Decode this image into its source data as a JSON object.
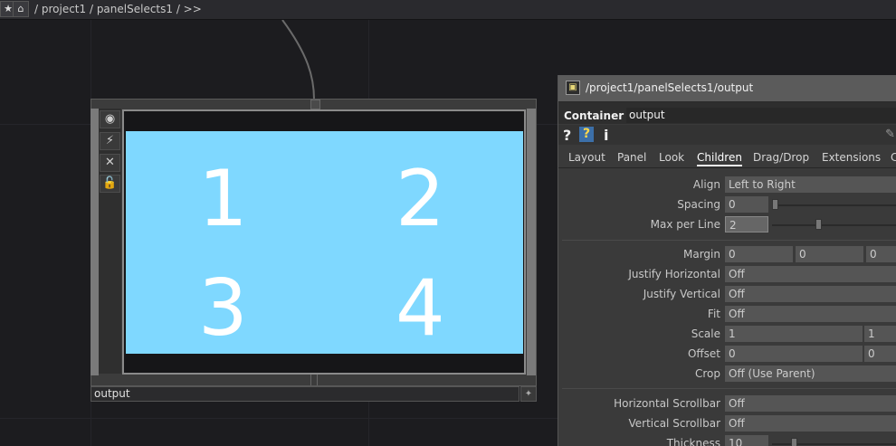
{
  "pathbar": {
    "path_text": "/ project1 / panelSelects1 / >>",
    "icons": [
      "pin-icon",
      "home-icon"
    ]
  },
  "node": {
    "name": "output",
    "viewer_color": "#7fd8ff",
    "digits": [
      "1",
      "2",
      "3",
      "4"
    ],
    "icons": [
      "viewer-active-icon",
      "bypass-icon",
      "cross-icon",
      "lock-icon"
    ]
  },
  "panel": {
    "title": "/project1/panelSelects1/output",
    "op_type": "Container",
    "op_name": "output",
    "help_icons": [
      "?",
      "?",
      "i"
    ],
    "tabs": [
      "Layout",
      "Panel",
      "Look",
      "Children",
      "Drag/Drop",
      "Extensions",
      "C"
    ],
    "active_tab": "Children",
    "params": {
      "align": {
        "label": "Align",
        "value": "Left to Right"
      },
      "spacing": {
        "label": "Spacing",
        "value": "0",
        "slider_fraction": 0.0
      },
      "max_per_line": {
        "label": "Max per Line",
        "value": "2",
        "slider_fraction": 0.4
      },
      "margin": {
        "label": "Margin",
        "values": [
          "0",
          "0",
          "0"
        ]
      },
      "justify_horizontal": {
        "label": "Justify Horizontal",
        "value": "Off"
      },
      "justify_vertical": {
        "label": "Justify Vertical",
        "value": "Off"
      },
      "fit": {
        "label": "Fit",
        "value": "Off"
      },
      "scale": {
        "label": "Scale",
        "values": [
          "1",
          "1"
        ]
      },
      "offset": {
        "label": "Offset",
        "values": [
          "0",
          "0"
        ]
      },
      "crop": {
        "label": "Crop",
        "value": "Off (Use Parent)"
      },
      "horizontal_scrollbar": {
        "label": "Horizontal Scrollbar",
        "value": "Off"
      },
      "vertical_scrollbar": {
        "label": "Vertical Scrollbar",
        "value": "Off"
      },
      "thickness": {
        "label": "Thickness",
        "value": "10",
        "slider_fraction": 0.2
      }
    }
  }
}
